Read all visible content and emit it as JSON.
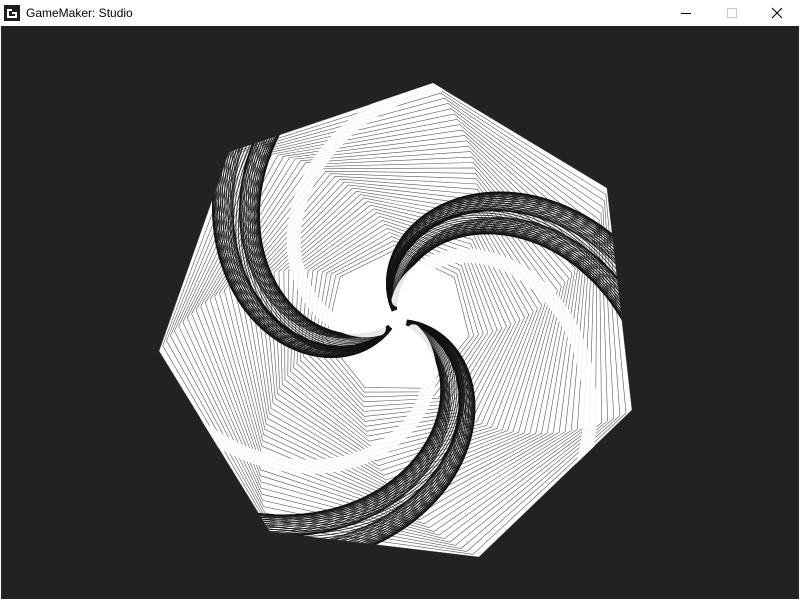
{
  "window": {
    "title": "GameMaker: Studio",
    "icon": "gamemaker-icon",
    "controls": [
      "minimize-icon",
      "maximize-icon",
      "close-icon"
    ]
  },
  "colors": {
    "background": "#222222",
    "line": "#ffffff",
    "titlebar": "#ffffff"
  },
  "artwork": {
    "shape": "heptagon",
    "arms": 3
  }
}
